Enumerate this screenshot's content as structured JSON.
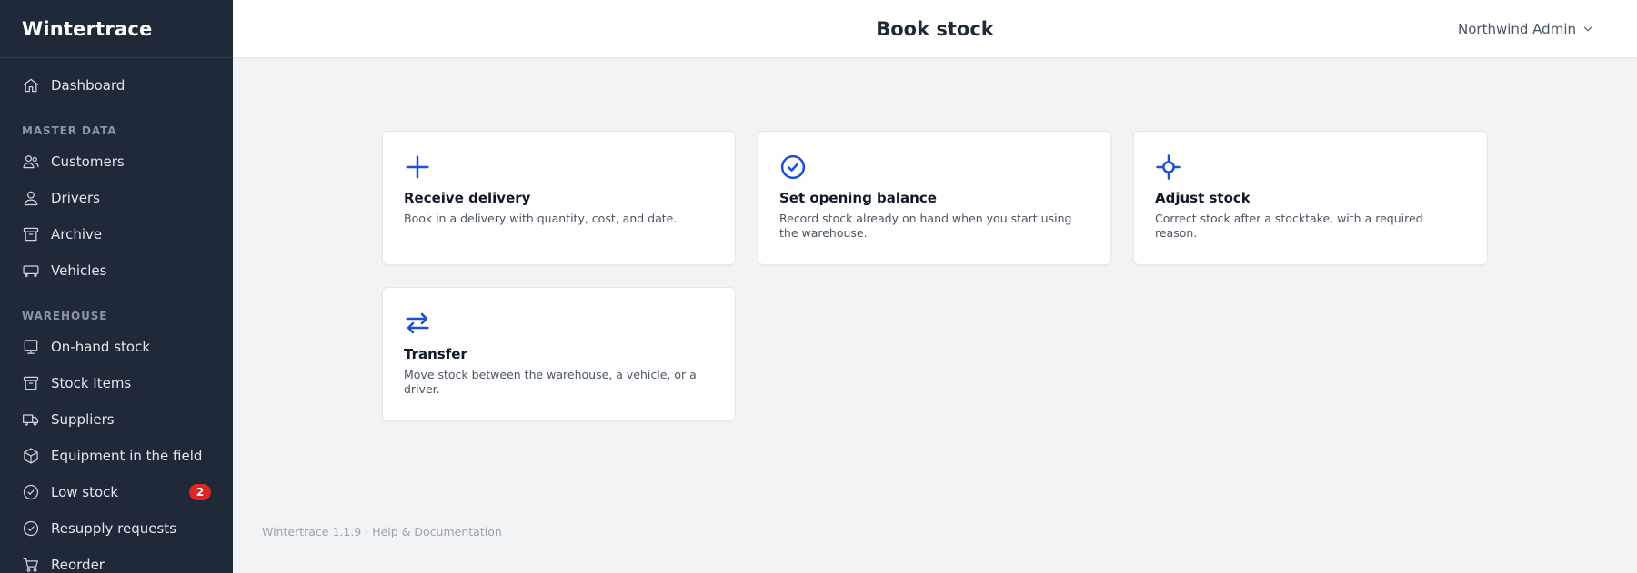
{
  "app": {
    "name": "Wintertrace"
  },
  "header": {
    "title": "Book stock",
    "user_label": "Northwind Admin"
  },
  "sidebar": {
    "top_items": [
      {
        "label": "Dashboard",
        "icon": "home-icon"
      }
    ],
    "sections": [
      {
        "label": "MASTER DATA",
        "items": [
          {
            "label": "Customers",
            "icon": "users-icon"
          },
          {
            "label": "Drivers",
            "icon": "user-icon"
          },
          {
            "label": "Archive",
            "icon": "archive-icon"
          },
          {
            "label": "Vehicles",
            "icon": "vehicle-icon"
          }
        ]
      },
      {
        "label": "WAREHOUSE",
        "items": [
          {
            "label": "On-hand stock",
            "icon": "display-icon"
          },
          {
            "label": "Stock Items",
            "icon": "archive-icon"
          },
          {
            "label": "Suppliers",
            "icon": "truck-icon"
          },
          {
            "label": "Equipment in the field",
            "icon": "cube-icon"
          },
          {
            "label": "Low stock",
            "icon": "check-circle-icon",
            "badge": "2"
          },
          {
            "label": "Resupply requests",
            "icon": "check-circle-icon"
          },
          {
            "label": "Reorder",
            "icon": "cart-icon"
          }
        ]
      }
    ]
  },
  "cards": [
    {
      "title": "Receive delivery",
      "description": "Book in a delivery with quantity, cost, and date.",
      "icon": "plus-icon"
    },
    {
      "title": "Set opening balance",
      "description": "Record stock already on hand when you start using the warehouse.",
      "icon": "check-circle-icon"
    },
    {
      "title": "Adjust stock",
      "description": "Correct stock after a stocktake, with a required reason.",
      "icon": "crosshair-icon"
    },
    {
      "title": "Transfer",
      "description": "Move stock between the warehouse, a vehicle, or a driver.",
      "icon": "arrows-exchange-icon"
    }
  ],
  "footer": {
    "version": "Wintertrace 1.1.9",
    "separator": "·",
    "help_link": "Help & Documentation"
  },
  "colors": {
    "sidebar_bg": "#1f2937",
    "accent": "#1d4ed8",
    "badge": "#dc2626",
    "page_bg": "#f2f3f5"
  }
}
